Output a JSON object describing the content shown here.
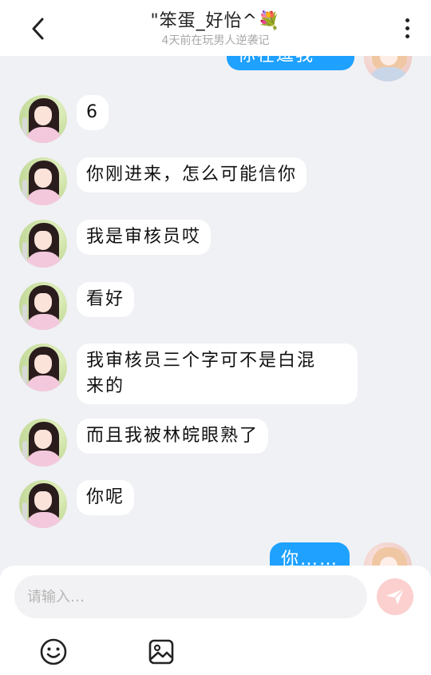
{
  "header": {
    "title": "\"笨蛋_好怡^💐",
    "subtitle": "4天前在玩男人逆袭记"
  },
  "messages_top_partial": "你在逗我",
  "messages": [
    {
      "from": "other",
      "text": "6"
    },
    {
      "from": "other",
      "text": "你刚进来，怎么可能信你"
    },
    {
      "from": "other",
      "text": "我是审核员哎"
    },
    {
      "from": "other",
      "text": "看好"
    },
    {
      "from": "other",
      "text": "我审核员三个字可不是白混来的",
      "line1": "我审核员三个字可不是白混",
      "line2": "来的"
    },
    {
      "from": "other",
      "text": "而且我被林皖眼熟了"
    },
    {
      "from": "other",
      "text": "你呢"
    },
    {
      "from": "me",
      "text": "你……"
    }
  ],
  "composer": {
    "placeholder": "请输入…"
  },
  "icons": {
    "back": "chevron-left-icon",
    "more": "more-vertical-icon",
    "send": "send-icon",
    "emoji": "emoji-icon",
    "image": "image-icon"
  },
  "colors": {
    "my_bubble": "#1ea1ff",
    "background": "#f0f1f5",
    "send_disabled": "#fbd0cf"
  }
}
